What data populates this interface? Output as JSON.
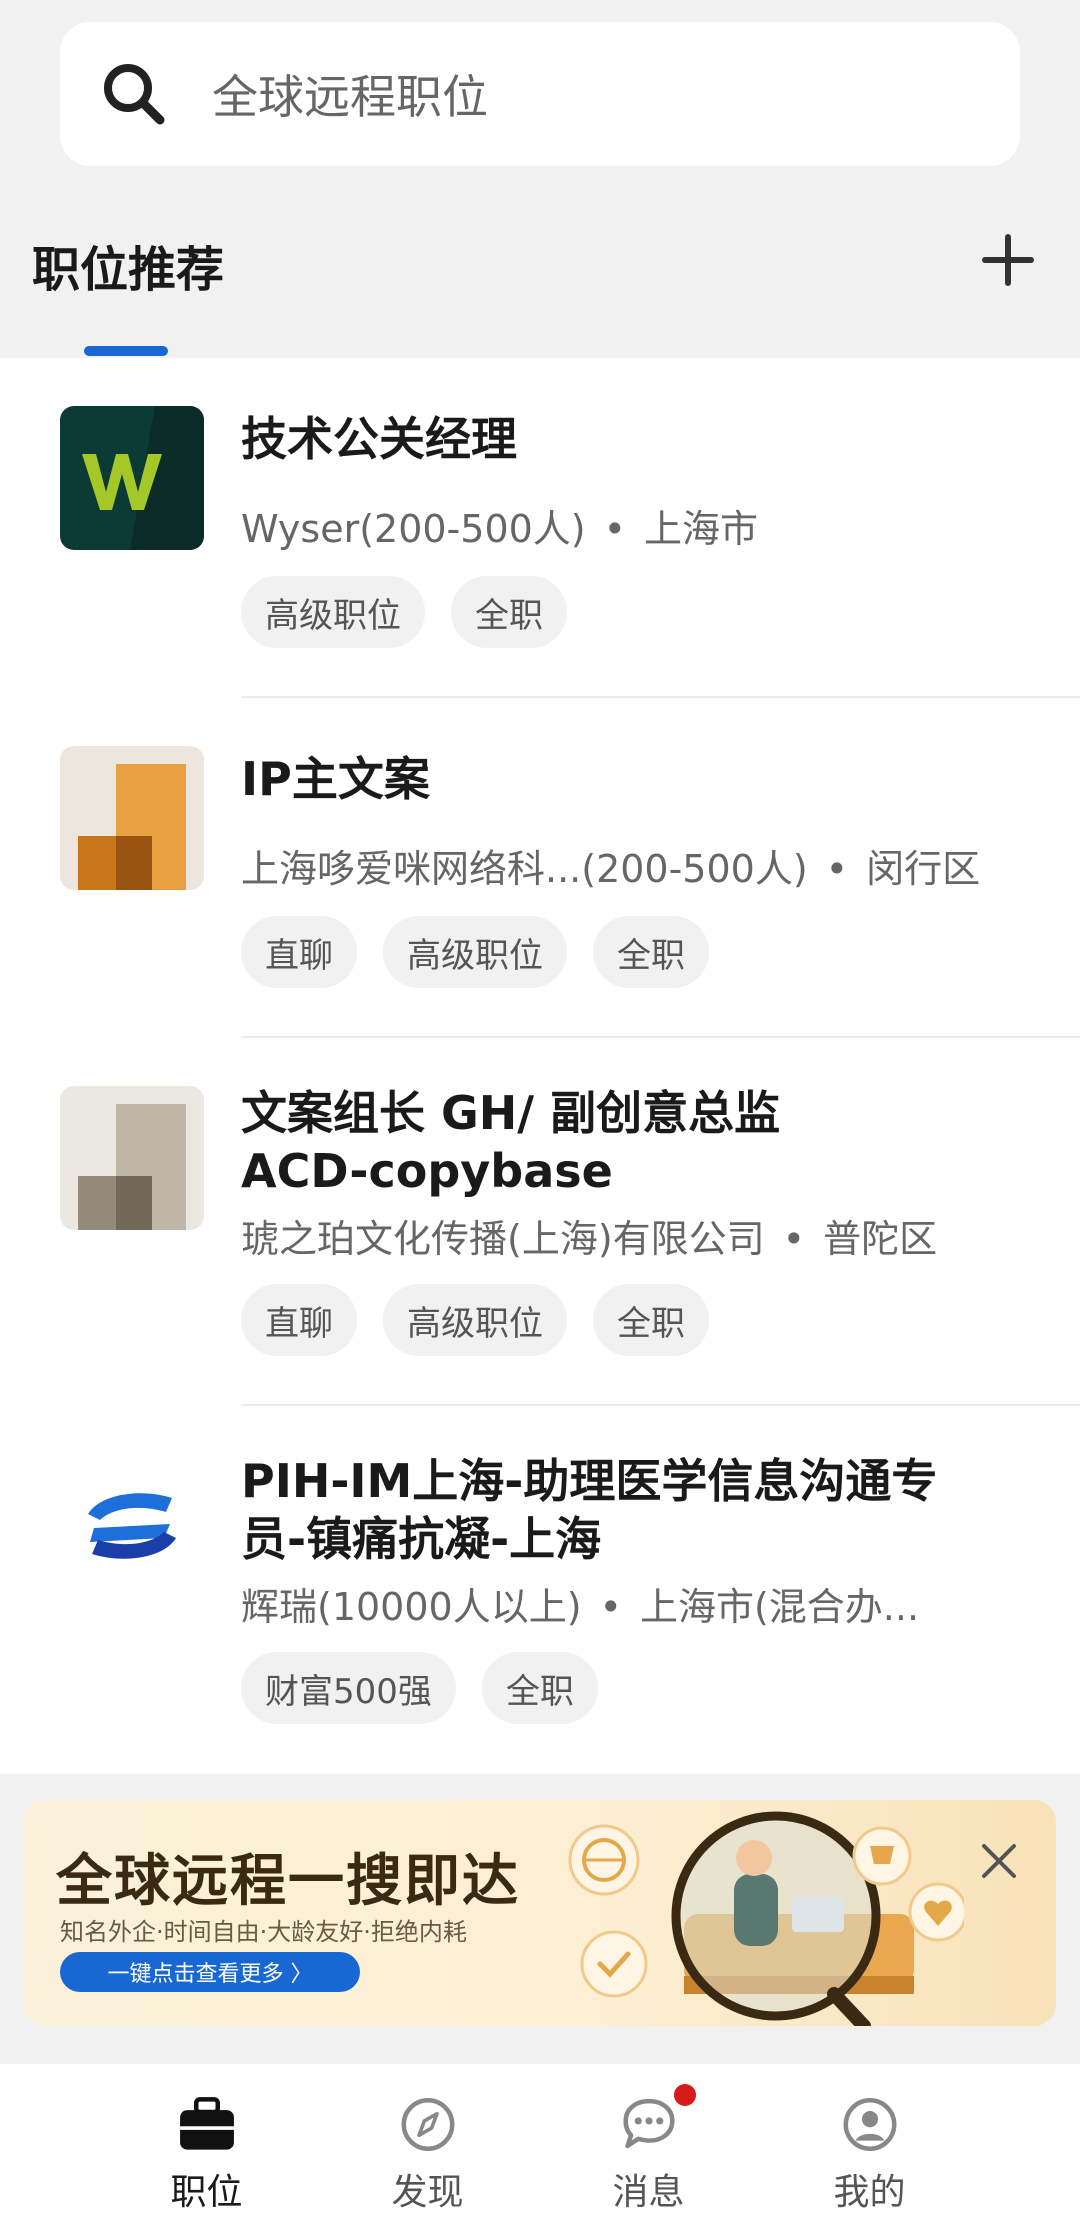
{
  "search": {
    "placeholder": "全球远程职位"
  },
  "section": {
    "title": "职位推荐"
  },
  "jobs": [
    {
      "title": "技术公关经理",
      "company": "Wyser(200-500人)",
      "location": "上海市",
      "tags": [
        "高级职位",
        "全职"
      ],
      "logo_text": "W"
    },
    {
      "title": "IP主文案",
      "company": "上海哆爱咪网络科...(200-500人)",
      "location": "闵行区",
      "tags": [
        "直聊",
        "高级职位",
        "全职"
      ]
    },
    {
      "title": "文案组长 GH/ 副创意总监 ACD-copybase",
      "company": "琥之珀文化传播(上海)有限公司",
      "location": "普陀区",
      "tags": [
        "直聊",
        "高级职位",
        "全职"
      ]
    },
    {
      "title": "PIH-IM上海-助理医学信息沟通专员-镇痛抗凝-上海",
      "company": "辉瑞(10000人以上)",
      "location": "上海市(混合办...",
      "tags": [
        "财富500强",
        "全职"
      ]
    }
  ],
  "banner": {
    "title": "全球远程一搜即达",
    "subtitle": "知名外企·时间自由·大龄友好·拒绝内耗",
    "button": "一键点击查看更多 〉"
  },
  "nav": [
    {
      "label": "职位",
      "icon": "briefcase-icon"
    },
    {
      "label": "发现",
      "icon": "compass-icon"
    },
    {
      "label": "消息",
      "icon": "chat-icon"
    },
    {
      "label": "我的",
      "icon": "profile-icon"
    }
  ],
  "colors": {
    "accent": "#1967d2",
    "badge": "#d71a1a"
  }
}
